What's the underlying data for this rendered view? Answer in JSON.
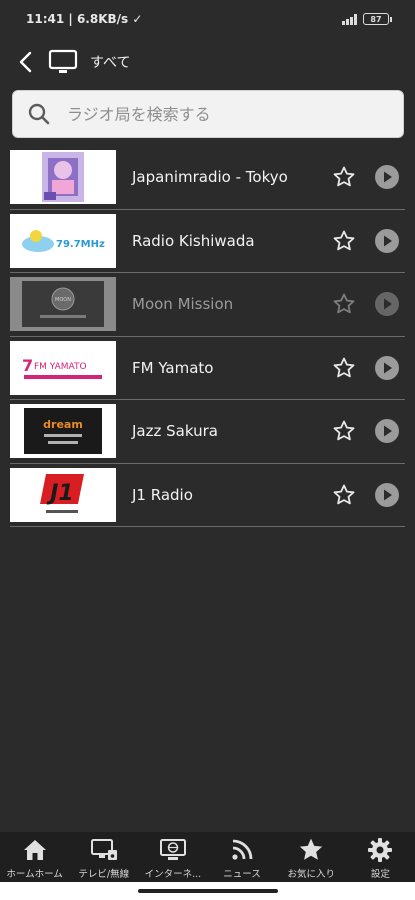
{
  "status": {
    "time": "11:41",
    "speed": "6.8KB/s",
    "battery": "87"
  },
  "header": {
    "title": "すべて"
  },
  "search": {
    "placeholder": "ラジオ局を検索する"
  },
  "stations": [
    {
      "name": "Japanimradio - Tokyo",
      "logo_text": "",
      "dim": false
    },
    {
      "name": "Radio Kishiwada",
      "logo_text": "79.7MHz",
      "dim": false
    },
    {
      "name": "Moon Mission",
      "logo_text": "MOON",
      "dim": true
    },
    {
      "name": "FM Yamato",
      "logo_text": "FM YAMATO",
      "dim": false
    },
    {
      "name": "Jazz Sakura",
      "logo_text": "dream",
      "dim": false
    },
    {
      "name": "J1 Radio",
      "logo_text": "J1",
      "dim": false
    }
  ],
  "nav": [
    {
      "label": "ホームホーム",
      "icon": "home-icon"
    },
    {
      "label": "テレビ/無線",
      "icon": "tv-radio-icon"
    },
    {
      "label": "インターネ...",
      "icon": "internet-icon"
    },
    {
      "label": "ニュース",
      "icon": "rss-icon"
    },
    {
      "label": "お気に入り",
      "icon": "star-icon"
    },
    {
      "label": "設定",
      "icon": "gear-icon"
    }
  ],
  "colors": {
    "background": "#2b2b2b",
    "nav_background": "#1f1f1f",
    "active_underline": "#e63b3b"
  }
}
